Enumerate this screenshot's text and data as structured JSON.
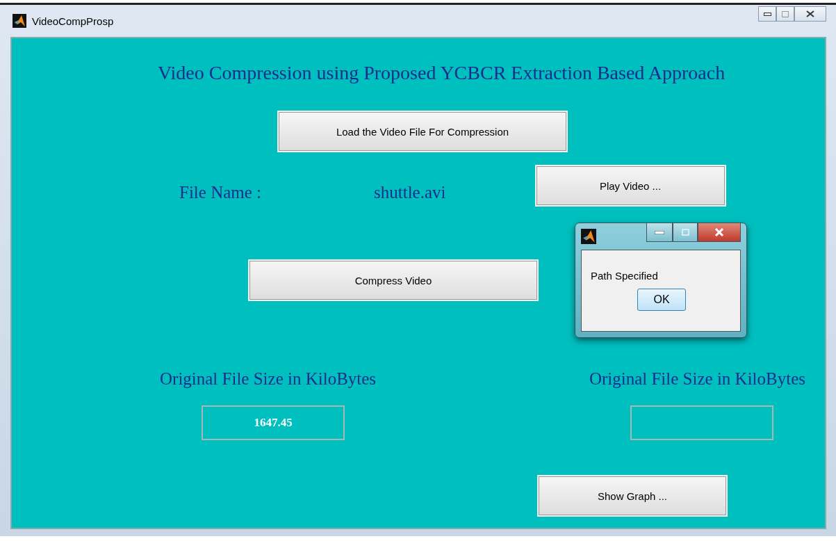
{
  "window": {
    "title": "VideoCompProsp"
  },
  "heading": "Video Compression using Proposed YCBCR Extraction Based Approach",
  "buttons": {
    "load": "Load the Video File For Compression",
    "play": "Play Video ...",
    "compress": "Compress Video",
    "graph": "Show Graph ..."
  },
  "file_name": {
    "label": "File Name :",
    "value": "shuttle.avi"
  },
  "sizes": [
    {
      "label": "Original File Size in KiloBytes",
      "value": "1647.45"
    },
    {
      "label": "Original File Size in KiloBytes"
    }
  ],
  "dialog": {
    "message": "Path Specified",
    "button": "OK"
  }
}
